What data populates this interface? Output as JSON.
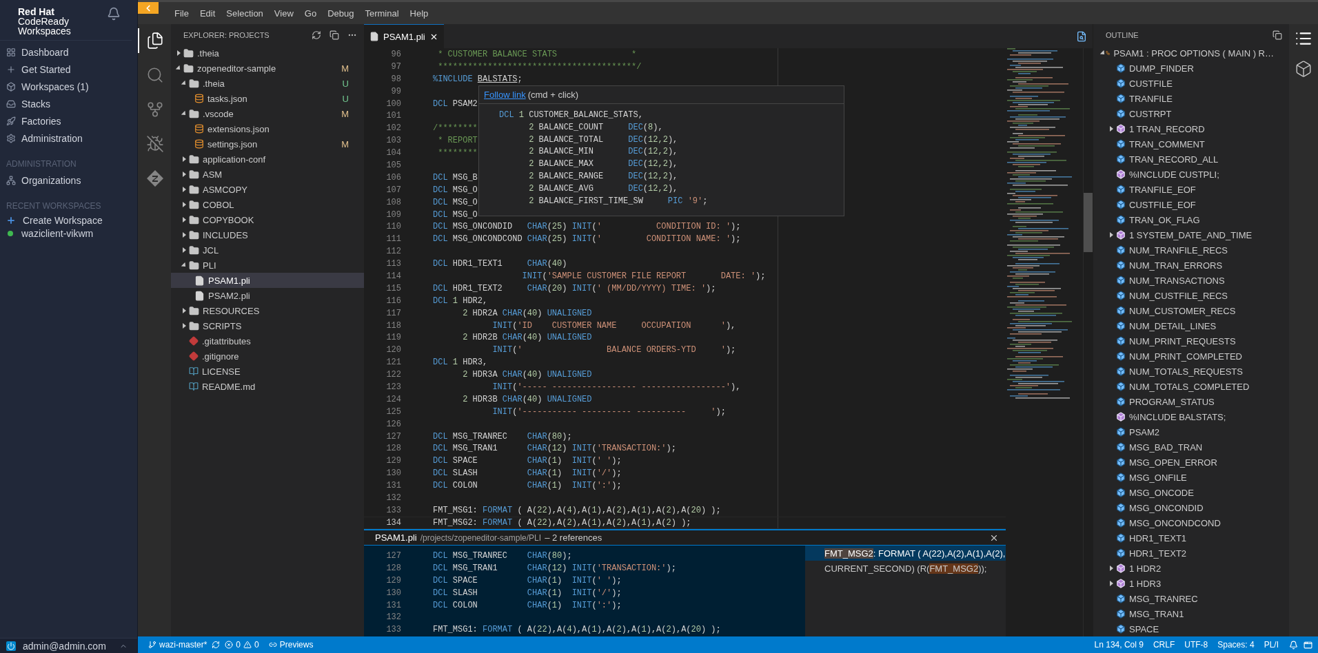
{
  "sidebar": {
    "brand": {
      "line1": "Red Hat",
      "line2": "CodeReady",
      "line3": "Workspaces"
    },
    "nav": [
      {
        "label": "Dashboard"
      },
      {
        "label": "Get Started"
      },
      {
        "label": "Workspaces (1)"
      },
      {
        "label": "Stacks"
      },
      {
        "label": "Factories"
      },
      {
        "label": "Administration"
      }
    ],
    "admin_section": {
      "title": "ADMINISTRATION",
      "items": [
        {
          "label": "Organizations"
        }
      ]
    },
    "recent_section": {
      "title": "RECENT WORKSPACES",
      "items": [
        {
          "label": "Create Workspace",
          "kind": "action"
        },
        {
          "label": "waziclient-vikwm",
          "kind": "workspace",
          "color": "#3fb950"
        }
      ]
    },
    "user": "admin@admin.com"
  },
  "menu": [
    "File",
    "Edit",
    "Selection",
    "View",
    "Go",
    "Debug",
    "Terminal",
    "Help"
  ],
  "activity_bar": [
    {
      "selected": true
    },
    {
      "selected": false
    },
    {
      "selected": false
    },
    {
      "selected": false
    },
    {
      "selected": false
    }
  ],
  "explorer": {
    "title": "EXPLORER: PROJECTS",
    "tree": [
      {
        "label": ".theia",
        "kind": "folder",
        "expanded": false,
        "selected": false
      },
      {
        "label": "zopeneditor-sample",
        "kind": "folder",
        "expanded": true,
        "selected": false,
        "badge": "M",
        "color": "#e2c08d",
        "children": [
          {
            "label": ".theia",
            "kind": "folder",
            "expanded": true,
            "selected": false,
            "badge": "U",
            "color": "#73c991",
            "children": [
              {
                "label": "tasks.json",
                "kind": "json",
                "selected": false,
                "badge": "U",
                "color": "#73c991"
              }
            ]
          },
          {
            "label": ".vscode",
            "kind": "folder",
            "expanded": true,
            "selected": false,
            "badge": "M",
            "color": "#e2c08d",
            "children": [
              {
                "label": "extensions.json",
                "kind": "json",
                "selected": false
              },
              {
                "label": "settings.json",
                "kind": "json",
                "selected": false,
                "badge": "M",
                "color": "#e2c08d"
              }
            ]
          },
          {
            "label": "application-conf",
            "kind": "folder",
            "expanded": false,
            "selected": false
          },
          {
            "label": "ASM",
            "kind": "folder",
            "expanded": false,
            "selected": false
          },
          {
            "label": "ASMCOPY",
            "kind": "folder",
            "expanded": false,
            "selected": false
          },
          {
            "label": "COBOL",
            "kind": "folder",
            "expanded": false,
            "selected": false
          },
          {
            "label": "COPYBOOK",
            "kind": "folder",
            "expanded": false,
            "selected": false
          },
          {
            "label": "INCLUDES",
            "kind": "folder",
            "expanded": false,
            "selected": false
          },
          {
            "label": "JCL",
            "kind": "folder",
            "expanded": false,
            "selected": false
          },
          {
            "label": "PLI",
            "kind": "folder",
            "expanded": true,
            "selected": false,
            "children": [
              {
                "label": "PSAM1.pli",
                "kind": "file",
                "selected": true
              },
              {
                "label": "PSAM2.pli",
                "kind": "file",
                "selected": false
              }
            ]
          },
          {
            "label": "RESOURCES",
            "kind": "folder",
            "expanded": false,
            "selected": false
          },
          {
            "label": "SCRIPTS",
            "kind": "folder",
            "expanded": false,
            "selected": false
          },
          {
            "label": ".gitattributes",
            "kind": "git",
            "selected": false
          },
          {
            "label": ".gitignore",
            "kind": "git",
            "selected": false
          },
          {
            "label": "LICENSE",
            "kind": "doc",
            "selected": false
          },
          {
            "label": "README.md",
            "kind": "doc",
            "selected": false
          }
        ]
      }
    ]
  },
  "editor": {
    "tabs": [
      {
        "label": "PSAM1.pli",
        "selected": true
      }
    ],
    "lines": [
      {
        "number": "96",
        "current": false,
        "tokens": [
          {
            "kind": "comment",
            "text": " * CUSTOMER BALANCE STATS               *"
          }
        ]
      },
      {
        "number": "97",
        "current": false,
        "tokens": [
          {
            "kind": "comment",
            "text": " ****************************************/"
          }
        ]
      },
      {
        "number": "98",
        "current": false,
        "tokens": [
          {
            "kind": "keyword",
            "text": "%INCLUDE "
          },
          {
            "kind": "link",
            "text": "BALSTATS"
          },
          {
            "kind": "text",
            "text": ";"
          }
        ]
      },
      {
        "number": "99",
        "current": false
      },
      {
        "number": "100",
        "current": false,
        "tokens": [
          {
            "kind": "keyword",
            "text": "DCL"
          },
          {
            "kind": "text",
            "text": " PSAM2"
          }
        ]
      },
      {
        "number": "101",
        "current": false
      },
      {
        "number": "102",
        "current": false,
        "tokens": [
          {
            "kind": "comment",
            "text": "/********"
          }
        ]
      },
      {
        "number": "103",
        "current": false,
        "tokens": [
          {
            "kind": "comment",
            "text": " * REPORT"
          }
        ]
      },
      {
        "number": "104",
        "current": false,
        "tokens": [
          {
            "kind": "comment",
            "text": " ********"
          }
        ]
      },
      {
        "number": "105",
        "current": false
      },
      {
        "number": "106",
        "current": false,
        "tokens": [
          {
            "kind": "keyword",
            "text": "DCL"
          },
          {
            "kind": "text",
            "text": " MSG_B"
          }
        ]
      },
      {
        "number": "107",
        "current": false,
        "tokens": [
          {
            "kind": "keyword",
            "text": "DCL"
          },
          {
            "kind": "text",
            "text": " MSG_O"
          }
        ]
      },
      {
        "number": "108",
        "current": false,
        "tokens": [
          {
            "kind": "keyword",
            "text": "DCL"
          },
          {
            "kind": "text",
            "text": " MSG_O"
          }
        ]
      },
      {
        "number": "109",
        "current": false,
        "tokens": [
          {
            "kind": "keyword",
            "text": "DCL"
          },
          {
            "kind": "text",
            "text": " MSG_O"
          }
        ]
      },
      {
        "number": "110",
        "current": false,
        "tokens": [
          {
            "kind": "keyword",
            "text": "DCL"
          },
          {
            "kind": "text",
            "text": " MSG_ONCONDID   "
          },
          {
            "kind": "keyword",
            "text": "CHAR"
          },
          {
            "kind": "text",
            "text": "("
          },
          {
            "kind": "number",
            "text": "25"
          },
          {
            "kind": "text",
            "text": ") "
          },
          {
            "kind": "keyword",
            "text": "INIT"
          },
          {
            "kind": "text",
            "text": "("
          },
          {
            "kind": "string",
            "text": "'           CONDITION ID: '"
          },
          {
            "kind": "text",
            "text": ");"
          }
        ]
      },
      {
        "number": "111",
        "current": false,
        "tokens": [
          {
            "kind": "keyword",
            "text": "DCL"
          },
          {
            "kind": "text",
            "text": " MSG_ONCONDCOND "
          },
          {
            "kind": "keyword",
            "text": "CHAR"
          },
          {
            "kind": "text",
            "text": "("
          },
          {
            "kind": "number",
            "text": "25"
          },
          {
            "kind": "text",
            "text": ") "
          },
          {
            "kind": "keyword",
            "text": "INIT"
          },
          {
            "kind": "text",
            "text": "("
          },
          {
            "kind": "string",
            "text": "'         CONDITION NAME: '"
          },
          {
            "kind": "text",
            "text": ");"
          }
        ]
      },
      {
        "number": "112",
        "current": false
      },
      {
        "number": "113",
        "current": false,
        "tokens": [
          {
            "kind": "keyword",
            "text": "DCL"
          },
          {
            "kind": "text",
            "text": " HDR1_TEXT1     "
          },
          {
            "kind": "keyword",
            "text": "CHAR"
          },
          {
            "kind": "text",
            "text": "("
          },
          {
            "kind": "number",
            "text": "40"
          },
          {
            "kind": "text",
            "text": ")"
          }
        ]
      },
      {
        "number": "114",
        "current": false,
        "tokens": [
          {
            "kind": "keyword",
            "text": "                  INIT"
          },
          {
            "kind": "text",
            "text": "("
          },
          {
            "kind": "string",
            "text": "'SAMPLE CUSTOMER FILE REPORT       DATE: '"
          },
          {
            "kind": "text",
            "text": ");"
          }
        ]
      },
      {
        "number": "115",
        "current": false,
        "tokens": [
          {
            "kind": "keyword",
            "text": "DCL"
          },
          {
            "kind": "text",
            "text": " HDR1_TEXT2     "
          },
          {
            "kind": "keyword",
            "text": "CHAR"
          },
          {
            "kind": "text",
            "text": "("
          },
          {
            "kind": "number",
            "text": "20"
          },
          {
            "kind": "text",
            "text": ") "
          },
          {
            "kind": "keyword",
            "text": "INIT"
          },
          {
            "kind": "text",
            "text": "("
          },
          {
            "kind": "string",
            "text": "' (MM/DD/YYYY) TIME: '"
          },
          {
            "kind": "text",
            "text": ");"
          }
        ]
      },
      {
        "number": "116",
        "current": false,
        "tokens": [
          {
            "kind": "keyword",
            "text": "DCL "
          },
          {
            "kind": "number",
            "text": "1"
          },
          {
            "kind": "text",
            "text": " HDR2,"
          }
        ]
      },
      {
        "number": "117",
        "current": false,
        "tokens": [
          {
            "kind": "number",
            "text": "      2"
          },
          {
            "kind": "text",
            "text": " HDR2A "
          },
          {
            "kind": "keyword",
            "text": "CHAR"
          },
          {
            "kind": "text",
            "text": "("
          },
          {
            "kind": "number",
            "text": "40"
          },
          {
            "kind": "text",
            "text": ") "
          },
          {
            "kind": "keyword",
            "text": "UNALIGNED"
          }
        ]
      },
      {
        "number": "118",
        "current": false,
        "tokens": [
          {
            "kind": "keyword",
            "text": "            INIT"
          },
          {
            "kind": "text",
            "text": "("
          },
          {
            "kind": "string",
            "text": "'ID    CUSTOMER NAME     OCCUPATION      '"
          },
          {
            "kind": "text",
            "text": "),"
          }
        ]
      },
      {
        "number": "119",
        "current": false,
        "tokens": [
          {
            "kind": "number",
            "text": "      2"
          },
          {
            "kind": "text",
            "text": " HDR2B "
          },
          {
            "kind": "keyword",
            "text": "CHAR"
          },
          {
            "kind": "text",
            "text": "("
          },
          {
            "kind": "number",
            "text": "40"
          },
          {
            "kind": "text",
            "text": ") "
          },
          {
            "kind": "keyword",
            "text": "UNALIGNED"
          }
        ]
      },
      {
        "number": "120",
        "current": false,
        "tokens": [
          {
            "kind": "keyword",
            "text": "            INIT"
          },
          {
            "kind": "text",
            "text": "("
          },
          {
            "kind": "string",
            "text": "'                 BALANCE ORDERS-YTD     '"
          },
          {
            "kind": "text",
            "text": ");"
          }
        ]
      },
      {
        "number": "121",
        "current": false,
        "tokens": [
          {
            "kind": "keyword",
            "text": "DCL "
          },
          {
            "kind": "number",
            "text": "1"
          },
          {
            "kind": "text",
            "text": " HDR3,"
          }
        ]
      },
      {
        "number": "122",
        "current": false,
        "tokens": [
          {
            "kind": "number",
            "text": "      2"
          },
          {
            "kind": "text",
            "text": " HDR3A "
          },
          {
            "kind": "keyword",
            "text": "CHAR"
          },
          {
            "kind": "text",
            "text": "("
          },
          {
            "kind": "number",
            "text": "40"
          },
          {
            "kind": "text",
            "text": ") "
          },
          {
            "kind": "keyword",
            "text": "UNALIGNED"
          }
        ]
      },
      {
        "number": "123",
        "current": false,
        "tokens": [
          {
            "kind": "keyword",
            "text": "            INIT"
          },
          {
            "kind": "text",
            "text": "("
          },
          {
            "kind": "string",
            "text": "'----- ----------------- -----------------'"
          },
          {
            "kind": "text",
            "text": "),"
          }
        ]
      },
      {
        "number": "124",
        "current": false,
        "tokens": [
          {
            "kind": "number",
            "text": "      2"
          },
          {
            "kind": "text",
            "text": " HDR3B "
          },
          {
            "kind": "keyword",
            "text": "CHAR"
          },
          {
            "kind": "text",
            "text": "("
          },
          {
            "kind": "number",
            "text": "40"
          },
          {
            "kind": "text",
            "text": ") "
          },
          {
            "kind": "keyword",
            "text": "UNALIGNED"
          }
        ]
      },
      {
        "number": "125",
        "current": false,
        "tokens": [
          {
            "kind": "keyword",
            "text": "            INIT"
          },
          {
            "kind": "text",
            "text": "("
          },
          {
            "kind": "string",
            "text": "'----------- ---------- ----------     '"
          },
          {
            "kind": "text",
            "text": ");"
          }
        ]
      },
      {
        "number": "126",
        "current": false
      },
      {
        "number": "127",
        "current": false,
        "tokens": [
          {
            "kind": "keyword",
            "text": "DCL"
          },
          {
            "kind": "text",
            "text": " MSG_TRANREC    "
          },
          {
            "kind": "keyword",
            "text": "CHAR"
          },
          {
            "kind": "text",
            "text": "("
          },
          {
            "kind": "number",
            "text": "80"
          },
          {
            "kind": "text",
            "text": ");"
          }
        ]
      },
      {
        "number": "128",
        "current": false,
        "tokens": [
          {
            "kind": "keyword",
            "text": "DCL"
          },
          {
            "kind": "text",
            "text": " MSG_TRAN1      "
          },
          {
            "kind": "keyword",
            "text": "CHAR"
          },
          {
            "kind": "text",
            "text": "("
          },
          {
            "kind": "number",
            "text": "12"
          },
          {
            "kind": "text",
            "text": ") "
          },
          {
            "kind": "keyword",
            "text": "INIT"
          },
          {
            "kind": "text",
            "text": "("
          },
          {
            "kind": "string",
            "text": "'TRANSACTION:'"
          },
          {
            "kind": "text",
            "text": ");"
          }
        ]
      },
      {
        "number": "129",
        "current": false,
        "tokens": [
          {
            "kind": "keyword",
            "text": "DCL"
          },
          {
            "kind": "text",
            "text": " SPACE          "
          },
          {
            "kind": "keyword",
            "text": "CHAR"
          },
          {
            "kind": "text",
            "text": "("
          },
          {
            "kind": "number",
            "text": "1"
          },
          {
            "kind": "text",
            "text": ")  "
          },
          {
            "kind": "keyword",
            "text": "INIT"
          },
          {
            "kind": "text",
            "text": "("
          },
          {
            "kind": "string",
            "text": "' '"
          },
          {
            "kind": "text",
            "text": ");"
          }
        ]
      },
      {
        "number": "130",
        "current": false,
        "tokens": [
          {
            "kind": "keyword",
            "text": "DCL"
          },
          {
            "kind": "text",
            "text": " SLASH          "
          },
          {
            "kind": "keyword",
            "text": "CHAR"
          },
          {
            "kind": "text",
            "text": "("
          },
          {
            "kind": "number",
            "text": "1"
          },
          {
            "kind": "text",
            "text": ")  "
          },
          {
            "kind": "keyword",
            "text": "INIT"
          },
          {
            "kind": "text",
            "text": "("
          },
          {
            "kind": "string",
            "text": "'/'"
          },
          {
            "kind": "text",
            "text": ");"
          }
        ]
      },
      {
        "number": "131",
        "current": false,
        "tokens": [
          {
            "kind": "keyword",
            "text": "DCL"
          },
          {
            "kind": "text",
            "text": " COLON          "
          },
          {
            "kind": "keyword",
            "text": "CHAR"
          },
          {
            "kind": "text",
            "text": "("
          },
          {
            "kind": "number",
            "text": "1"
          },
          {
            "kind": "text",
            "text": ")  "
          },
          {
            "kind": "keyword",
            "text": "INIT"
          },
          {
            "kind": "text",
            "text": "("
          },
          {
            "kind": "string",
            "text": "':'"
          },
          {
            "kind": "text",
            "text": ");"
          }
        ]
      },
      {
        "number": "132",
        "current": false
      },
      {
        "number": "133",
        "current": false,
        "tokens": [
          {
            "kind": "text",
            "text": "FMT_MSG1: "
          },
          {
            "kind": "keyword",
            "text": "FORMAT"
          },
          {
            "kind": "text",
            "text": " ( A("
          },
          {
            "kind": "number",
            "text": "22"
          },
          {
            "kind": "text",
            "text": "),A("
          },
          {
            "kind": "number",
            "text": "4"
          },
          {
            "kind": "text",
            "text": "),A("
          },
          {
            "kind": "number",
            "text": "1"
          },
          {
            "kind": "text",
            "text": "),A("
          },
          {
            "kind": "number",
            "text": "2"
          },
          {
            "kind": "text",
            "text": "),A("
          },
          {
            "kind": "number",
            "text": "1"
          },
          {
            "kind": "text",
            "text": "),A("
          },
          {
            "kind": "number",
            "text": "2"
          },
          {
            "kind": "text",
            "text": "),A("
          },
          {
            "kind": "number",
            "text": "20"
          },
          {
            "kind": "text",
            "text": ") );"
          }
        ]
      },
      {
        "number": "134",
        "current": true,
        "tokens": [
          {
            "kind": "text",
            "text": "FMT_MSG2: "
          },
          {
            "kind": "keyword",
            "text": "FORMAT"
          },
          {
            "kind": "text",
            "text": " ( A("
          },
          {
            "kind": "number",
            "text": "22"
          },
          {
            "kind": "text",
            "text": "),A("
          },
          {
            "kind": "number",
            "text": "2"
          },
          {
            "kind": "text",
            "text": "),A("
          },
          {
            "kind": "number",
            "text": "1"
          },
          {
            "kind": "text",
            "text": "),A("
          },
          {
            "kind": "number",
            "text": "2"
          },
          {
            "kind": "text",
            "text": "),A("
          },
          {
            "kind": "number",
            "text": "1"
          },
          {
            "kind": "text",
            "text": "),A("
          },
          {
            "kind": "number",
            "text": "2"
          },
          {
            "kind": "text",
            "text": ") );"
          }
        ]
      }
    ],
    "hover": {
      "link": "Follow link",
      "hint": "(cmd + click)",
      "lines": [
        {
          "tokens": [
            {
              "kind": "keyword",
              "text": "DCL "
            },
            {
              "kind": "number",
              "text": "1"
            },
            {
              "kind": "text",
              "text": " CUSTOMER_BALANCE_STATS,"
            }
          ]
        },
        {
          "tokens": [
            {
              "kind": "number",
              "text": "      2"
            },
            {
              "kind": "text",
              "text": " BALANCE_COUNT     "
            },
            {
              "kind": "keyword",
              "text": "DEC"
            },
            {
              "kind": "text",
              "text": "("
            },
            {
              "kind": "number",
              "text": "8"
            },
            {
              "kind": "text",
              "text": "),"
            }
          ]
        },
        {
          "tokens": [
            {
              "kind": "number",
              "text": "      2"
            },
            {
              "kind": "text",
              "text": " BALANCE_TOTAL     "
            },
            {
              "kind": "keyword",
              "text": "DEC"
            },
            {
              "kind": "text",
              "text": "("
            },
            {
              "kind": "number",
              "text": "12,2"
            },
            {
              "kind": "text",
              "text": "),"
            }
          ]
        },
        {
          "tokens": [
            {
              "kind": "number",
              "text": "      2"
            },
            {
              "kind": "text",
              "text": " BALANCE_MIN       "
            },
            {
              "kind": "keyword",
              "text": "DEC"
            },
            {
              "kind": "text",
              "text": "("
            },
            {
              "kind": "number",
              "text": "12,2"
            },
            {
              "kind": "text",
              "text": "),"
            }
          ]
        },
        {
          "tokens": [
            {
              "kind": "number",
              "text": "      2"
            },
            {
              "kind": "text",
              "text": " BALANCE_MAX       "
            },
            {
              "kind": "keyword",
              "text": "DEC"
            },
            {
              "kind": "text",
              "text": "("
            },
            {
              "kind": "number",
              "text": "12,2"
            },
            {
              "kind": "text",
              "text": "),"
            }
          ]
        },
        {
          "tokens": [
            {
              "kind": "number",
              "text": "      2"
            },
            {
              "kind": "text",
              "text": " BALANCE_RANGE     "
            },
            {
              "kind": "keyword",
              "text": "DEC"
            },
            {
              "kind": "text",
              "text": "("
            },
            {
              "kind": "number",
              "text": "12,2"
            },
            {
              "kind": "text",
              "text": "),"
            }
          ]
        },
        {
          "tokens": [
            {
              "kind": "number",
              "text": "      2"
            },
            {
              "kind": "text",
              "text": " BALANCE_AVG       "
            },
            {
              "kind": "keyword",
              "text": "DEC"
            },
            {
              "kind": "text",
              "text": "("
            },
            {
              "kind": "number",
              "text": "12,2"
            },
            {
              "kind": "text",
              "text": "),"
            }
          ]
        },
        {
          "tokens": [
            {
              "kind": "number",
              "text": "      2"
            },
            {
              "kind": "text",
              "text": " BALANCE_FIRST_TIME_SW     "
            },
            {
              "kind": "keyword",
              "text": "PIC "
            },
            {
              "kind": "string",
              "text": "'9'"
            },
            {
              "kind": "text",
              "text": ";"
            }
          ]
        }
      ]
    }
  },
  "peek": {
    "file": "PSAM1.pli",
    "path": "/projects/zopeneditor-sample/PLI",
    "summary": "– 2 references",
    "lines": [
      {
        "number": "127",
        "tokens": [
          {
            "kind": "keyword",
            "text": "DCL"
          },
          {
            "kind": "text",
            "text": " MSG_TRANREC    "
          },
          {
            "kind": "keyword",
            "text": "CHAR"
          },
          {
            "kind": "text",
            "text": "("
          },
          {
            "kind": "number",
            "text": "80"
          },
          {
            "kind": "text",
            "text": ");"
          }
        ]
      },
      {
        "number": "128",
        "tokens": [
          {
            "kind": "keyword",
            "text": "DCL"
          },
          {
            "kind": "text",
            "text": " MSG_TRAN1      "
          },
          {
            "kind": "keyword",
            "text": "CHAR"
          },
          {
            "kind": "text",
            "text": "("
          },
          {
            "kind": "number",
            "text": "12"
          },
          {
            "kind": "text",
            "text": ") "
          },
          {
            "kind": "keyword",
            "text": "INIT"
          },
          {
            "kind": "text",
            "text": "("
          },
          {
            "kind": "string",
            "text": "'TRANSACTION:'"
          },
          {
            "kind": "text",
            "text": ");"
          }
        ]
      },
      {
        "number": "129",
        "tokens": [
          {
            "kind": "keyword",
            "text": "DCL"
          },
          {
            "kind": "text",
            "text": " SPACE          "
          },
          {
            "kind": "keyword",
            "text": "CHAR"
          },
          {
            "kind": "text",
            "text": "("
          },
          {
            "kind": "number",
            "text": "1"
          },
          {
            "kind": "text",
            "text": ")  "
          },
          {
            "kind": "keyword",
            "text": "INIT"
          },
          {
            "kind": "text",
            "text": "("
          },
          {
            "kind": "string",
            "text": "' '"
          },
          {
            "kind": "text",
            "text": ");"
          }
        ]
      },
      {
        "number": "130",
        "tokens": [
          {
            "kind": "keyword",
            "text": "DCL"
          },
          {
            "kind": "text",
            "text": " SLASH          "
          },
          {
            "kind": "keyword",
            "text": "CHAR"
          },
          {
            "kind": "text",
            "text": "("
          },
          {
            "kind": "number",
            "text": "1"
          },
          {
            "kind": "text",
            "text": ")  "
          },
          {
            "kind": "keyword",
            "text": "INIT"
          },
          {
            "kind": "text",
            "text": "("
          },
          {
            "kind": "string",
            "text": "'/'"
          },
          {
            "kind": "text",
            "text": ");"
          }
        ]
      },
      {
        "number": "131",
        "tokens": [
          {
            "kind": "keyword",
            "text": "DCL"
          },
          {
            "kind": "text",
            "text": " COLON          "
          },
          {
            "kind": "keyword",
            "text": "CHAR"
          },
          {
            "kind": "text",
            "text": "("
          },
          {
            "kind": "number",
            "text": "1"
          },
          {
            "kind": "text",
            "text": ")  "
          },
          {
            "kind": "keyword",
            "text": "INIT"
          },
          {
            "kind": "text",
            "text": "("
          },
          {
            "kind": "string",
            "text": "':'"
          },
          {
            "kind": "text",
            "text": ");"
          }
        ]
      },
      {
        "number": "132"
      },
      {
        "number": "133",
        "tokens": [
          {
            "kind": "text",
            "text": "FMT_MSG1: "
          },
          {
            "kind": "keyword",
            "text": "FORMAT"
          },
          {
            "kind": "text",
            "text": " ( A("
          },
          {
            "kind": "number",
            "text": "22"
          },
          {
            "kind": "text",
            "text": "),A("
          },
          {
            "kind": "number",
            "text": "4"
          },
          {
            "kind": "text",
            "text": "),A("
          },
          {
            "kind": "number",
            "text": "1"
          },
          {
            "kind": "text",
            "text": "),A("
          },
          {
            "kind": "number",
            "text": "2"
          },
          {
            "kind": "text",
            "text": "),A("
          },
          {
            "kind": "number",
            "text": "1"
          },
          {
            "kind": "text",
            "text": "),A("
          },
          {
            "kind": "number",
            "text": "2"
          },
          {
            "kind": "text",
            "text": "),A("
          },
          {
            "kind": "number",
            "text": "20"
          },
          {
            "kind": "text",
            "text": ") );"
          }
        ]
      }
    ],
    "references": [
      {
        "selected": true,
        "match": "FMT_MSG2",
        "after": ": FORMAT ( A(22),A(2),A(1),A(2),"
      },
      {
        "selected": false,
        "before": "CURRENT_SECOND) (R(",
        "match": "FMT_MSG2",
        "after": "));"
      }
    ]
  },
  "outline": {
    "title": "OUTLINE",
    "tree": [
      {
        "label": "PSAM1 : PROC OPTIONS ( MAIN ) R…",
        "kind": "procedure",
        "expanded": true,
        "children": [
          {
            "label": "DUMP_FINDER",
            "kind": "variable"
          },
          {
            "label": "CUSTFILE",
            "kind": "variable"
          },
          {
            "label": "TRANFILE",
            "kind": "variable"
          },
          {
            "label": "CUSTRPT",
            "kind": "variable"
          },
          {
            "label": "1 TRAN_RECORD",
            "kind": "structure",
            "expanded": false
          },
          {
            "label": "TRAN_COMMENT",
            "kind": "variable"
          },
          {
            "label": "TRAN_RECORD_ALL",
            "kind": "variable"
          },
          {
            "label": "%INCLUDE CUSTPLI;",
            "kind": "include"
          },
          {
            "label": "TRANFILE_EOF",
            "kind": "variable"
          },
          {
            "label": "CUSTFILE_EOF",
            "kind": "variable"
          },
          {
            "label": "TRAN_OK_FLAG",
            "kind": "variable"
          },
          {
            "label": "1 SYSTEM_DATE_AND_TIME",
            "kind": "structure",
            "expanded": false
          },
          {
            "label": "NUM_TRANFILE_RECS",
            "kind": "variable"
          },
          {
            "label": "NUM_TRAN_ERRORS",
            "kind": "variable"
          },
          {
            "label": "NUM_TRANSACTIONS",
            "kind": "variable"
          },
          {
            "label": "NUM_CUSTFILE_RECS",
            "kind": "variable"
          },
          {
            "label": "NUM_CUSTOMER_RECS",
            "kind": "variable"
          },
          {
            "label": "NUM_DETAIL_LINES",
            "kind": "variable"
          },
          {
            "label": "NUM_PRINT_REQUESTS",
            "kind": "variable"
          },
          {
            "label": "NUM_PRINT_COMPLETED",
            "kind": "variable"
          },
          {
            "label": "NUM_TOTALS_REQUESTS",
            "kind": "variable"
          },
          {
            "label": "NUM_TOTALS_COMPLETED",
            "kind": "variable"
          },
          {
            "label": "PROGRAM_STATUS",
            "kind": "variable"
          },
          {
            "label": "%INCLUDE BALSTATS;",
            "kind": "include"
          },
          {
            "label": "PSAM2",
            "kind": "variable"
          },
          {
            "label": "MSG_BAD_TRAN",
            "kind": "variable"
          },
          {
            "label": "MSG_OPEN_ERROR",
            "kind": "variable"
          },
          {
            "label": "MSG_ONFILE",
            "kind": "variable"
          },
          {
            "label": "MSG_ONCODE",
            "kind": "variable"
          },
          {
            "label": "MSG_ONCONDID",
            "kind": "variable"
          },
          {
            "label": "MSG_ONCONDCOND",
            "kind": "variable"
          },
          {
            "label": "HDR1_TEXT1",
            "kind": "variable"
          },
          {
            "label": "HDR1_TEXT2",
            "kind": "variable"
          },
          {
            "label": "1 HDR2",
            "kind": "structure",
            "expanded": false
          },
          {
            "label": "1 HDR3",
            "kind": "structure",
            "expanded": false
          },
          {
            "label": "MSG_TRANREC",
            "kind": "variable"
          },
          {
            "label": "MSG_TRAN1",
            "kind": "variable"
          },
          {
            "label": "SPACE",
            "kind": "variable"
          }
        ]
      }
    ]
  },
  "status_bar": {
    "branch": "wazi-master*",
    "errors": "0",
    "warnings": "0",
    "previews": "Previews",
    "position": "Ln 134, Col 9",
    "eol": "CRLF",
    "encoding": "UTF-8",
    "indent": "Spaces: 4",
    "language": "PL/I"
  }
}
